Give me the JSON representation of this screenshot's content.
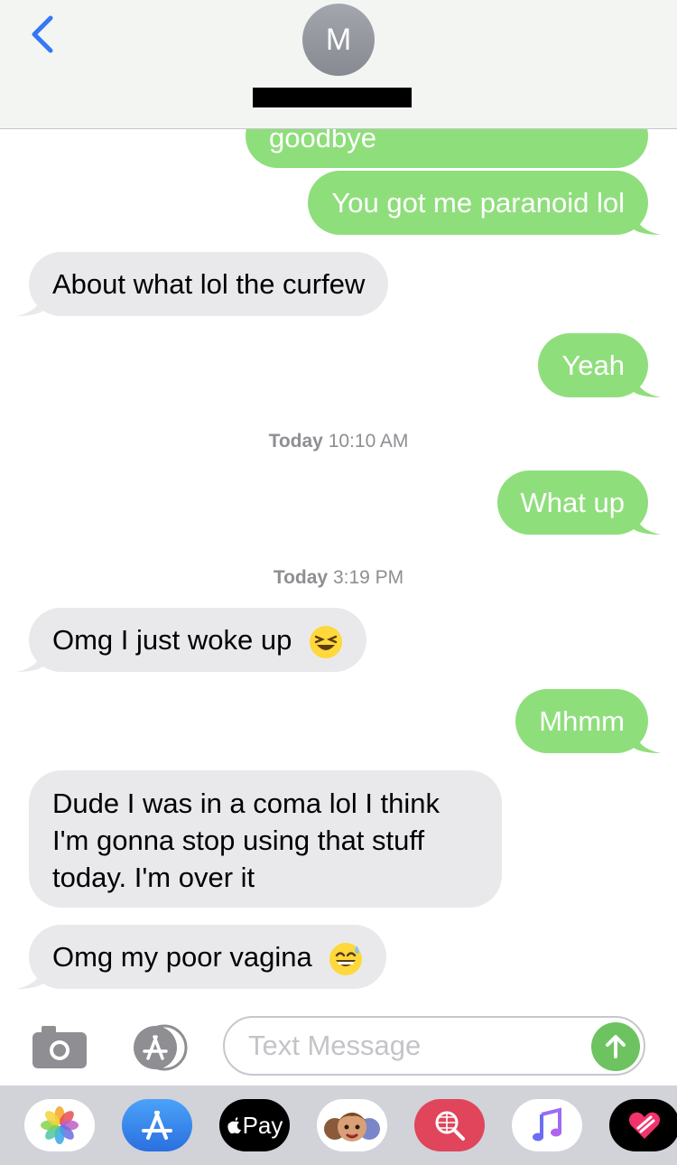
{
  "header": {
    "contact_initial": "M",
    "back_icon": "chevron-left-icon"
  },
  "messages": [
    {
      "id": "m0",
      "direction": "outgoing",
      "text": "goodbye"
    },
    {
      "id": "m1",
      "direction": "outgoing",
      "text": "You got me paranoid lol"
    },
    {
      "id": "m2",
      "direction": "incoming",
      "text": "About what lol the curfew"
    },
    {
      "id": "m3",
      "direction": "outgoing",
      "text": "Yeah"
    },
    {
      "id": "m4",
      "direction": "outgoing",
      "text": "What up"
    },
    {
      "id": "m5",
      "direction": "incoming",
      "text": "Omg I just woke up",
      "emoji": "😆"
    },
    {
      "id": "m6",
      "direction": "outgoing",
      "text": "Mhmm"
    },
    {
      "id": "m7",
      "direction": "incoming",
      "text": "Dude I was in a coma lol I think I'm gonna stop using that stuff today. I'm over it"
    },
    {
      "id": "m8",
      "direction": "incoming",
      "text": "Omg my poor vagina",
      "emoji": "😅"
    }
  ],
  "timestamps": [
    {
      "day": "Today",
      "time": "10:10 AM"
    },
    {
      "day": "Today",
      "time": "3:19 PM"
    }
  ],
  "composer": {
    "placeholder": "Text Message",
    "camera_icon": "camera-icon",
    "apps_icon": "app-store-icon",
    "send_icon": "send-arrow-icon"
  },
  "app_drawer": {
    "items": [
      {
        "name": "photos",
        "icon": "photos-icon"
      },
      {
        "name": "app-store",
        "icon": "app-store-icon"
      },
      {
        "name": "apple-pay",
        "label": "Pay",
        "icon": "apple-pay-icon"
      },
      {
        "name": "memoji",
        "icon": "memoji-icon"
      },
      {
        "name": "search-images",
        "icon": "globe-search-icon"
      },
      {
        "name": "music",
        "icon": "music-note-icon"
      },
      {
        "name": "digital-touch",
        "icon": "heart-icon"
      }
    ]
  },
  "colors": {
    "outgoing_bubble": "#8fde7c",
    "incoming_bubble": "#e9e9eb",
    "ios_blue": "#3478f6",
    "send_green": "#6cc35f"
  }
}
